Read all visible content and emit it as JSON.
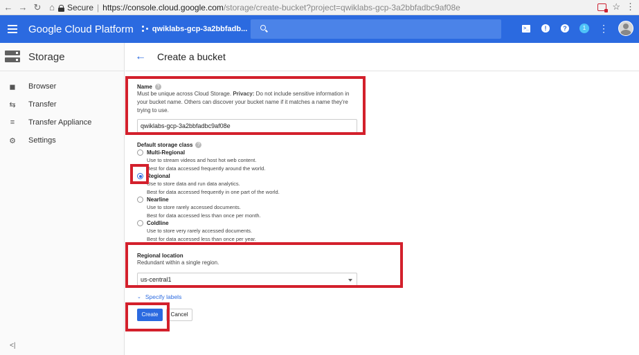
{
  "browser": {
    "secure_label": "Secure",
    "url_separator": "|",
    "url_host": "https://console.cloud.google.com",
    "url_path": "/storage/create-bucket?project=qwiklabs-gcp-3a2bbfadbc9af08e"
  },
  "appbar": {
    "brand": "Google Cloud Platform",
    "project": "qwiklabs-gcp-3a2bbfadb...",
    "notification_count": "1",
    "help_glyph": "?",
    "alert_glyph": "!",
    "terminal_glyph": ">_",
    "more_glyph": "⋮"
  },
  "sidebar": {
    "title": "Storage",
    "items": [
      {
        "label": "Browser",
        "icon": "bucket-icon"
      },
      {
        "label": "Transfer",
        "icon": "transfer-icon"
      },
      {
        "label": "Transfer Appliance",
        "icon": "list-icon"
      },
      {
        "label": "Settings",
        "icon": "gear-icon"
      }
    ],
    "collapse_glyph": "<|"
  },
  "page": {
    "title": "Create a bucket"
  },
  "form": {
    "name": {
      "label": "Name",
      "help_prefix": "Must be unique across Cloud Storage. ",
      "help_bold": "Privacy:",
      "help_line1_rest": " Do not include sensitive information in",
      "help_line2": "your bucket name. Others can discover your bucket name if it matches a name they're",
      "help_line3": "trying to use.",
      "value": "qwiklabs-gcp-3a2bbfadbc9af08e"
    },
    "storage_class": {
      "label": "Default storage class",
      "options": [
        {
          "title": "Multi-Regional",
          "desc1": "Use to stream videos and host hot web content.",
          "desc2": "Best for data accessed frequently around the world.",
          "checked": false
        },
        {
          "title": "Regional",
          "desc1": "Use to store data and run data analytics.",
          "desc2": "Best for data accessed frequently in one part of the world.",
          "checked": true
        },
        {
          "title": "Nearline",
          "desc1": "Use to store rarely accessed documents.",
          "desc2": "Best for data accessed less than once per month.",
          "checked": false
        },
        {
          "title": "Coldline",
          "desc1": "Use to store very rarely accessed documents.",
          "desc2": "Best for data accessed less than once per year.",
          "checked": false
        }
      ]
    },
    "location": {
      "label": "Regional location",
      "help": "Redundant within a single region.",
      "value": "us-central1"
    },
    "specify_labels": "Specify labels",
    "create_label": "Create",
    "cancel_label": "Cancel"
  },
  "colors": {
    "primary": "#2b6ae0",
    "highlight": "#d3202c"
  }
}
